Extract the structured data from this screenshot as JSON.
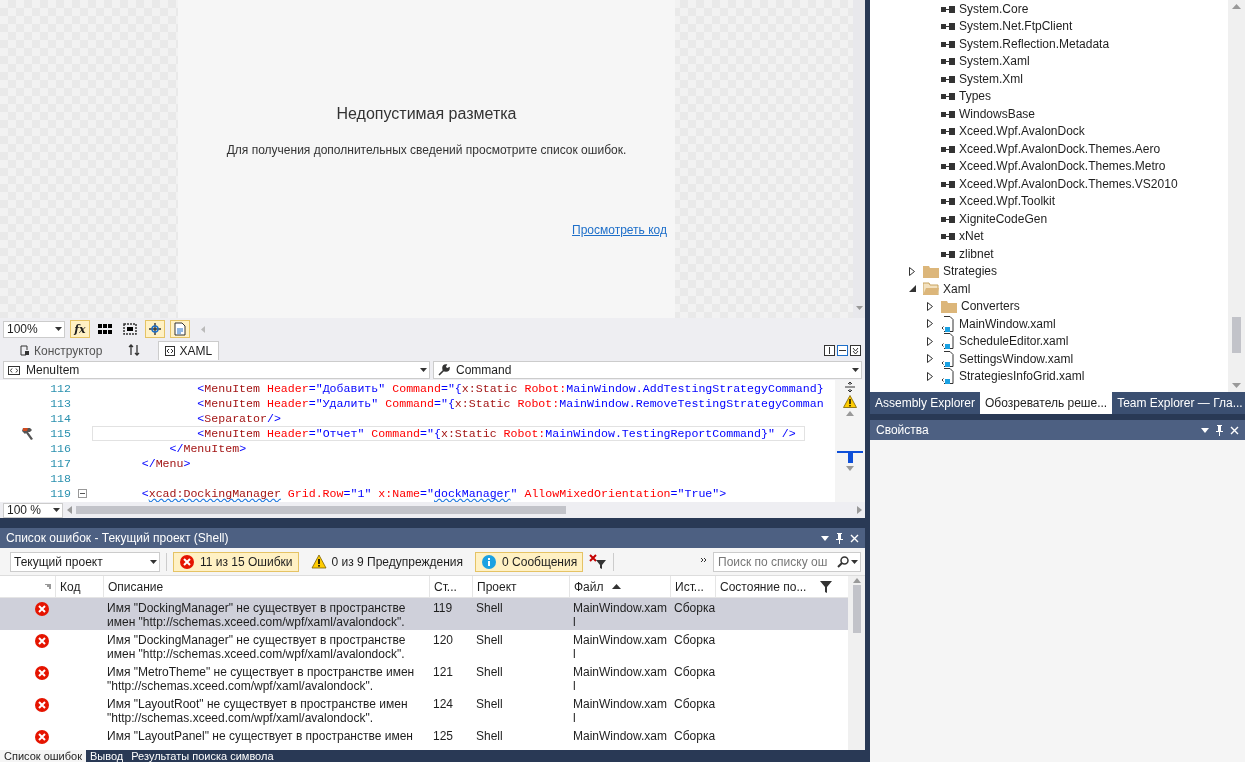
{
  "designer": {
    "title": "Недопустимая разметка",
    "message": "Для получения дополнительных сведений просмотрите список ошибок.",
    "link": "Просмотреть код",
    "zoom": "100%",
    "tools": [
      {
        "kind": "fx",
        "label": "fx",
        "on": true
      },
      {
        "kind": "grid",
        "on": false
      },
      {
        "kind": "snap-grid",
        "on": false
      },
      {
        "kind": "snap-lines",
        "on": true
      },
      {
        "kind": "effects",
        "on": true
      }
    ]
  },
  "editor_tabs": [
    {
      "kind": "design",
      "label": "Конструктор",
      "selected": false
    },
    {
      "kind": "xaml",
      "label": "XAML",
      "selected": true
    }
  ],
  "nav": {
    "element": "MenuItem",
    "member": "Command"
  },
  "code": {
    "zoom": "100 %",
    "lines": [
      {
        "number": "112",
        "current": false,
        "hint": false,
        "foldable": false,
        "tokens": [
          {
            "kind": "punct",
            "text": "               <"
          },
          {
            "kind": "tag",
            "text": "MenuItem"
          },
          {
            "kind": "attr",
            "text": " Header"
          },
          {
            "kind": "punct",
            "text": "=\""
          },
          {
            "kind": "value",
            "text": "Добавить"
          },
          {
            "kind": "punct",
            "text": "\""
          },
          {
            "kind": "attr",
            "text": " Command"
          },
          {
            "kind": "punct",
            "text": "=\"{"
          },
          {
            "kind": "tag",
            "text": "x:Static"
          },
          {
            "kind": "attr",
            "text": " Robot:"
          },
          {
            "kind": "value",
            "text": "MainWindow.AddTestingStrategyCommand"
          },
          {
            "kind": "punct",
            "text": "}"
          }
        ]
      },
      {
        "number": "113",
        "current": false,
        "hint": false,
        "foldable": false,
        "tokens": [
          {
            "kind": "punct",
            "text": "               <"
          },
          {
            "kind": "tag",
            "text": "MenuItem"
          },
          {
            "kind": "attr",
            "text": " Header"
          },
          {
            "kind": "punct",
            "text": "=\""
          },
          {
            "kind": "value",
            "text": "Удалить"
          },
          {
            "kind": "punct",
            "text": "\""
          },
          {
            "kind": "attr",
            "text": " Command"
          },
          {
            "kind": "punct",
            "text": "=\"{"
          },
          {
            "kind": "tag",
            "text": "x:Static"
          },
          {
            "kind": "attr",
            "text": " Robot:"
          },
          {
            "kind": "value",
            "text": "MainWindow.RemoveTestingStrategyComman"
          }
        ]
      },
      {
        "number": "114",
        "current": false,
        "hint": false,
        "foldable": false,
        "tokens": [
          {
            "kind": "punct",
            "text": "               <"
          },
          {
            "kind": "tag",
            "text": "Separator"
          },
          {
            "kind": "punct",
            "text": "/>"
          }
        ]
      },
      {
        "number": "115",
        "current": true,
        "hint": true,
        "foldable": false,
        "tokens": [
          {
            "kind": "punct",
            "text": "               <"
          },
          {
            "kind": "tag",
            "text": "MenuItem"
          },
          {
            "kind": "attr",
            "text": " Header"
          },
          {
            "kind": "punct",
            "text": "=\""
          },
          {
            "kind": "value",
            "text": "Отчет"
          },
          {
            "kind": "punct",
            "text": "\""
          },
          {
            "kind": "attr",
            "text": " Command"
          },
          {
            "kind": "punct",
            "text": "=\"{"
          },
          {
            "kind": "tag",
            "text": "x:Static"
          },
          {
            "kind": "attr",
            "text": " Robot:"
          },
          {
            "kind": "value",
            "text": "MainWindow.TestingReportCommand"
          },
          {
            "kind": "punct",
            "text": "}\" />"
          }
        ]
      },
      {
        "number": "116",
        "current": false,
        "hint": false,
        "foldable": false,
        "tokens": [
          {
            "kind": "punct",
            "text": "           </"
          },
          {
            "kind": "tag",
            "text": "MenuItem"
          },
          {
            "kind": "punct",
            "text": ">"
          }
        ]
      },
      {
        "number": "117",
        "current": false,
        "hint": false,
        "foldable": false,
        "tokens": [
          {
            "kind": "punct",
            "text": "       </"
          },
          {
            "kind": "tag",
            "text": "Menu"
          },
          {
            "kind": "punct",
            "text": ">"
          }
        ]
      },
      {
        "number": "118",
        "current": false,
        "hint": false,
        "foldable": false
      },
      {
        "number": "119",
        "current": false,
        "hint": false,
        "foldable": true,
        "tokens": [
          {
            "kind": "punct",
            "text": "       <"
          },
          {
            "kind": "tag",
            "text": "xcad:DockingManager",
            "squiggle": true
          },
          {
            "kind": "attr",
            "text": " Grid.Row"
          },
          {
            "kind": "punct",
            "text": "=\""
          },
          {
            "kind": "value",
            "text": "1"
          },
          {
            "kind": "punct",
            "text": "\""
          },
          {
            "kind": "attr",
            "text": " x:Name"
          },
          {
            "kind": "punct",
            "text": "=\""
          },
          {
            "kind": "value",
            "text": "dockManager",
            "squiggle": true
          },
          {
            "kind": "punct",
            "text": "\""
          },
          {
            "kind": "attr",
            "text": " AllowMixedOrientation"
          },
          {
            "kind": "punct",
            "text": "=\""
          },
          {
            "kind": "value",
            "text": "True"
          },
          {
            "kind": "punct",
            "text": "\">"
          }
        ]
      }
    ]
  },
  "error_list": {
    "title": "Список ошибок - Текущий проект (Shell)",
    "scope": "Текущий проект",
    "filters": [
      {
        "kind": "error",
        "label": "11 из 15 Ошибки",
        "on": true
      },
      {
        "kind": "warning",
        "label": "0 из 9 Предупреждения",
        "on": false
      },
      {
        "kind": "info",
        "label": "0 Сообщения",
        "on": true
      }
    ],
    "search_placeholder": "Поиск по списку ош",
    "columns": [
      {
        "label": "Код",
        "sorted": false
      },
      {
        "label": "Описание",
        "sorted": false
      },
      {
        "label": "Ст...",
        "sorted": false
      },
      {
        "label": "Проект",
        "sorted": false
      },
      {
        "label": "Файл",
        "sorted": true
      },
      {
        "label": "Ист...",
        "sorted": false
      },
      {
        "label": "Состояние по...",
        "sorted": false
      }
    ],
    "rows": [
      {
        "kind": "error",
        "selected": true,
        "description": [
          "Имя \"DockingManager\" не существует в пространстве",
          "имен \"http://schemas.xceed.com/wpf/xaml/avalondock\"."
        ],
        "line": "119",
        "project": "Shell",
        "file": [
          "MainWindow.xam",
          "l"
        ],
        "source": "Сборка"
      },
      {
        "kind": "error",
        "selected": false,
        "description": [
          "Имя \"DockingManager\" не существует в пространстве",
          "имен \"http://schemas.xceed.com/wpf/xaml/avalondock\"."
        ],
        "line": "120",
        "project": "Shell",
        "file": [
          "MainWindow.xam",
          "l"
        ],
        "source": "Сборка"
      },
      {
        "kind": "error",
        "selected": false,
        "description": [
          "Имя \"MetroTheme\" не существует в пространстве имен",
          "\"http://schemas.xceed.com/wpf/xaml/avalondock\"."
        ],
        "line": "121",
        "project": "Shell",
        "file": [
          "MainWindow.xam",
          "l"
        ],
        "source": "Сборка"
      },
      {
        "kind": "error",
        "selected": false,
        "description": [
          "Имя \"LayoutRoot\" не существует в пространстве имен",
          "\"http://schemas.xceed.com/wpf/xaml/avalondock\"."
        ],
        "line": "124",
        "project": "Shell",
        "file": [
          "MainWindow.xam",
          "l"
        ],
        "source": "Сборка"
      },
      {
        "kind": "error",
        "selected": false,
        "description": [
          "Имя \"LayoutPanel\" не существует в пространстве имен"
        ],
        "line": "125",
        "project": "Shell",
        "file": [
          "MainWindow.xam"
        ],
        "source": "Сборка"
      }
    ]
  },
  "bottom_tabs": [
    {
      "label": "Список ошибок",
      "selected": true
    },
    {
      "label": "Вывод",
      "selected": false
    },
    {
      "label": "Результаты поиска символа",
      "selected": false
    }
  ],
  "solution_tree": {
    "references": [
      "System.Core",
      "System.Net.FtpClient",
      "System.Reflection.Metadata",
      "System.Xaml",
      "System.Xml",
      "Types",
      "WindowsBase",
      "Xceed.Wpf.AvalonDock",
      "Xceed.Wpf.AvalonDock.Themes.Aero",
      "Xceed.Wpf.AvalonDock.Themes.Metro",
      "Xceed.Wpf.AvalonDock.Themes.VS2010",
      "Xceed.Wpf.Toolkit",
      "XigniteCodeGen",
      "xNet",
      "zlibnet"
    ],
    "items": [
      {
        "kind": "folder",
        "label": "Strategies",
        "expanded": false
      },
      {
        "kind": "folder",
        "label": "Xaml",
        "expanded": true,
        "children": [
          {
            "kind": "folder",
            "label": "Converters",
            "expanded": false
          },
          {
            "kind": "xaml",
            "label": "MainWindow.xaml",
            "expanded": false
          },
          {
            "kind": "xaml",
            "label": "ScheduleEditor.xaml",
            "expanded": false
          },
          {
            "kind": "xaml",
            "label": "SettingsWindow.xaml",
            "expanded": false
          },
          {
            "kind": "xaml",
            "label": "StrategiesInfoGrid.xaml",
            "expanded": false
          }
        ]
      }
    ]
  },
  "right_tabs": [
    {
      "label": "Assembly Explorer",
      "selected": false
    },
    {
      "label": "Обозреватель реше...",
      "selected": true
    },
    {
      "label": "Team Explorer — Гла...",
      "selected": false
    }
  ],
  "properties": {
    "title": "Свойства"
  }
}
